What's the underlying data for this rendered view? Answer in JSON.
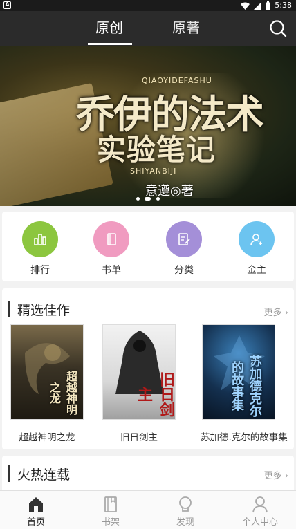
{
  "status_bar": {
    "time": "5:38",
    "app_badge": "A"
  },
  "header": {
    "tabs": [
      {
        "label": "原创",
        "active": true
      },
      {
        "label": "原著",
        "active": false
      }
    ]
  },
  "banner": {
    "pinyin_top": "QIAOYIDEFASHU",
    "title_line1": "乔伊的法术",
    "title_line2": "实验笔记",
    "pinyin_bottom": "SHIYANBIJI",
    "author": "意遵◎著",
    "slide_count": 3,
    "active_slide": 1
  },
  "categories": [
    {
      "label": "排行",
      "icon": "ranking-icon",
      "color": "#8cc63f"
    },
    {
      "label": "书单",
      "icon": "booklist-icon",
      "color": "#f09bc0"
    },
    {
      "label": "分类",
      "icon": "category-icon",
      "color": "#a48fd8"
    },
    {
      "label": "金主",
      "icon": "patron-icon",
      "color": "#6cc4f0"
    }
  ],
  "featured": {
    "title": "精选佳作",
    "more": "更多",
    "books": [
      {
        "name": "超越神明之龙",
        "cover_text": "超越神明之龙",
        "cover_color": "#3a3a2a"
      },
      {
        "name": "旧日剑主",
        "cover_text": "旧日剑主",
        "cover_color": "#d9d9d9"
      },
      {
        "name": "苏加德.克尔的故事集",
        "cover_text": "苏加德克尔的故事集",
        "cover_color": "#10253f"
      }
    ]
  },
  "hot": {
    "title": "火热连载",
    "more": "更多"
  },
  "bottom_nav": [
    {
      "label": "首页",
      "icon": "home-icon",
      "active": true
    },
    {
      "label": "书架",
      "icon": "bookshelf-icon",
      "active": false
    },
    {
      "label": "发现",
      "icon": "discover-icon",
      "active": false
    },
    {
      "label": "个人中心",
      "icon": "profile-icon",
      "active": false
    }
  ]
}
